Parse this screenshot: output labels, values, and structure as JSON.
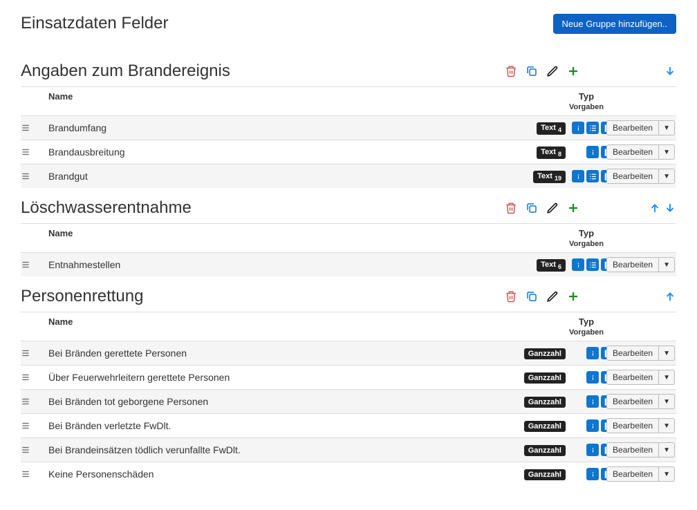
{
  "page": {
    "title": "Einsatzdaten Felder",
    "add_group_button": "Neue Gruppe hinzufügen.."
  },
  "headers": {
    "name": "Name",
    "typ": "Typ",
    "vorgaben": "Vorgaben",
    "edit": "Bearbeiten"
  },
  "groups": [
    {
      "title": "Angaben zum Brandereignis",
      "show_up": false,
      "show_down": true,
      "rows": [
        {
          "name": "Brandumfang",
          "type_label": "Text",
          "type_count": "4",
          "flags": [
            "info",
            "list",
            "page"
          ]
        },
        {
          "name": "Brandausbreitung",
          "type_label": "Text",
          "type_count": "8",
          "flags": [
            "info",
            "page"
          ]
        },
        {
          "name": "Brandgut",
          "type_label": "Text",
          "type_count": "19",
          "flags": [
            "info",
            "list",
            "page"
          ]
        }
      ]
    },
    {
      "title": "Löschwasserentnahme",
      "show_up": true,
      "show_down": true,
      "rows": [
        {
          "name": "Entnahmestellen",
          "type_label": "Text",
          "type_count": "6",
          "flags": [
            "info",
            "list",
            "page"
          ]
        }
      ]
    },
    {
      "title": "Personenrettung",
      "show_up": true,
      "show_down": false,
      "rows": [
        {
          "name": "Bei Bränden gerettete Personen",
          "type_label": "Ganzzahl",
          "type_count": "",
          "flags": [
            "info",
            "page"
          ]
        },
        {
          "name": "Über Feuerwehrleitern gerettete Personen",
          "type_label": "Ganzzahl",
          "type_count": "",
          "flags": [
            "info",
            "page"
          ]
        },
        {
          "name": "Bei Bränden tot geborgene Personen",
          "type_label": "Ganzzahl",
          "type_count": "",
          "flags": [
            "info",
            "page"
          ]
        },
        {
          "name": "Bei Bränden verletzte FwDlt.",
          "type_label": "Ganzzahl",
          "type_count": "",
          "flags": [
            "info",
            "page"
          ]
        },
        {
          "name": "Bei Brandeinsätzen tödlich verunfallte FwDlt.",
          "type_label": "Ganzzahl",
          "type_count": "",
          "flags": [
            "info",
            "page"
          ]
        },
        {
          "name": "Keine Personenschäden",
          "type_label": "Ganzzahl",
          "type_count": "",
          "flags": [
            "info",
            "page"
          ]
        }
      ]
    }
  ],
  "colors": {
    "delete": "#d9534f",
    "copy": "#0d76d1",
    "edit": "#000",
    "add": "#1a8c1a",
    "arrow": "#1a8cff"
  }
}
